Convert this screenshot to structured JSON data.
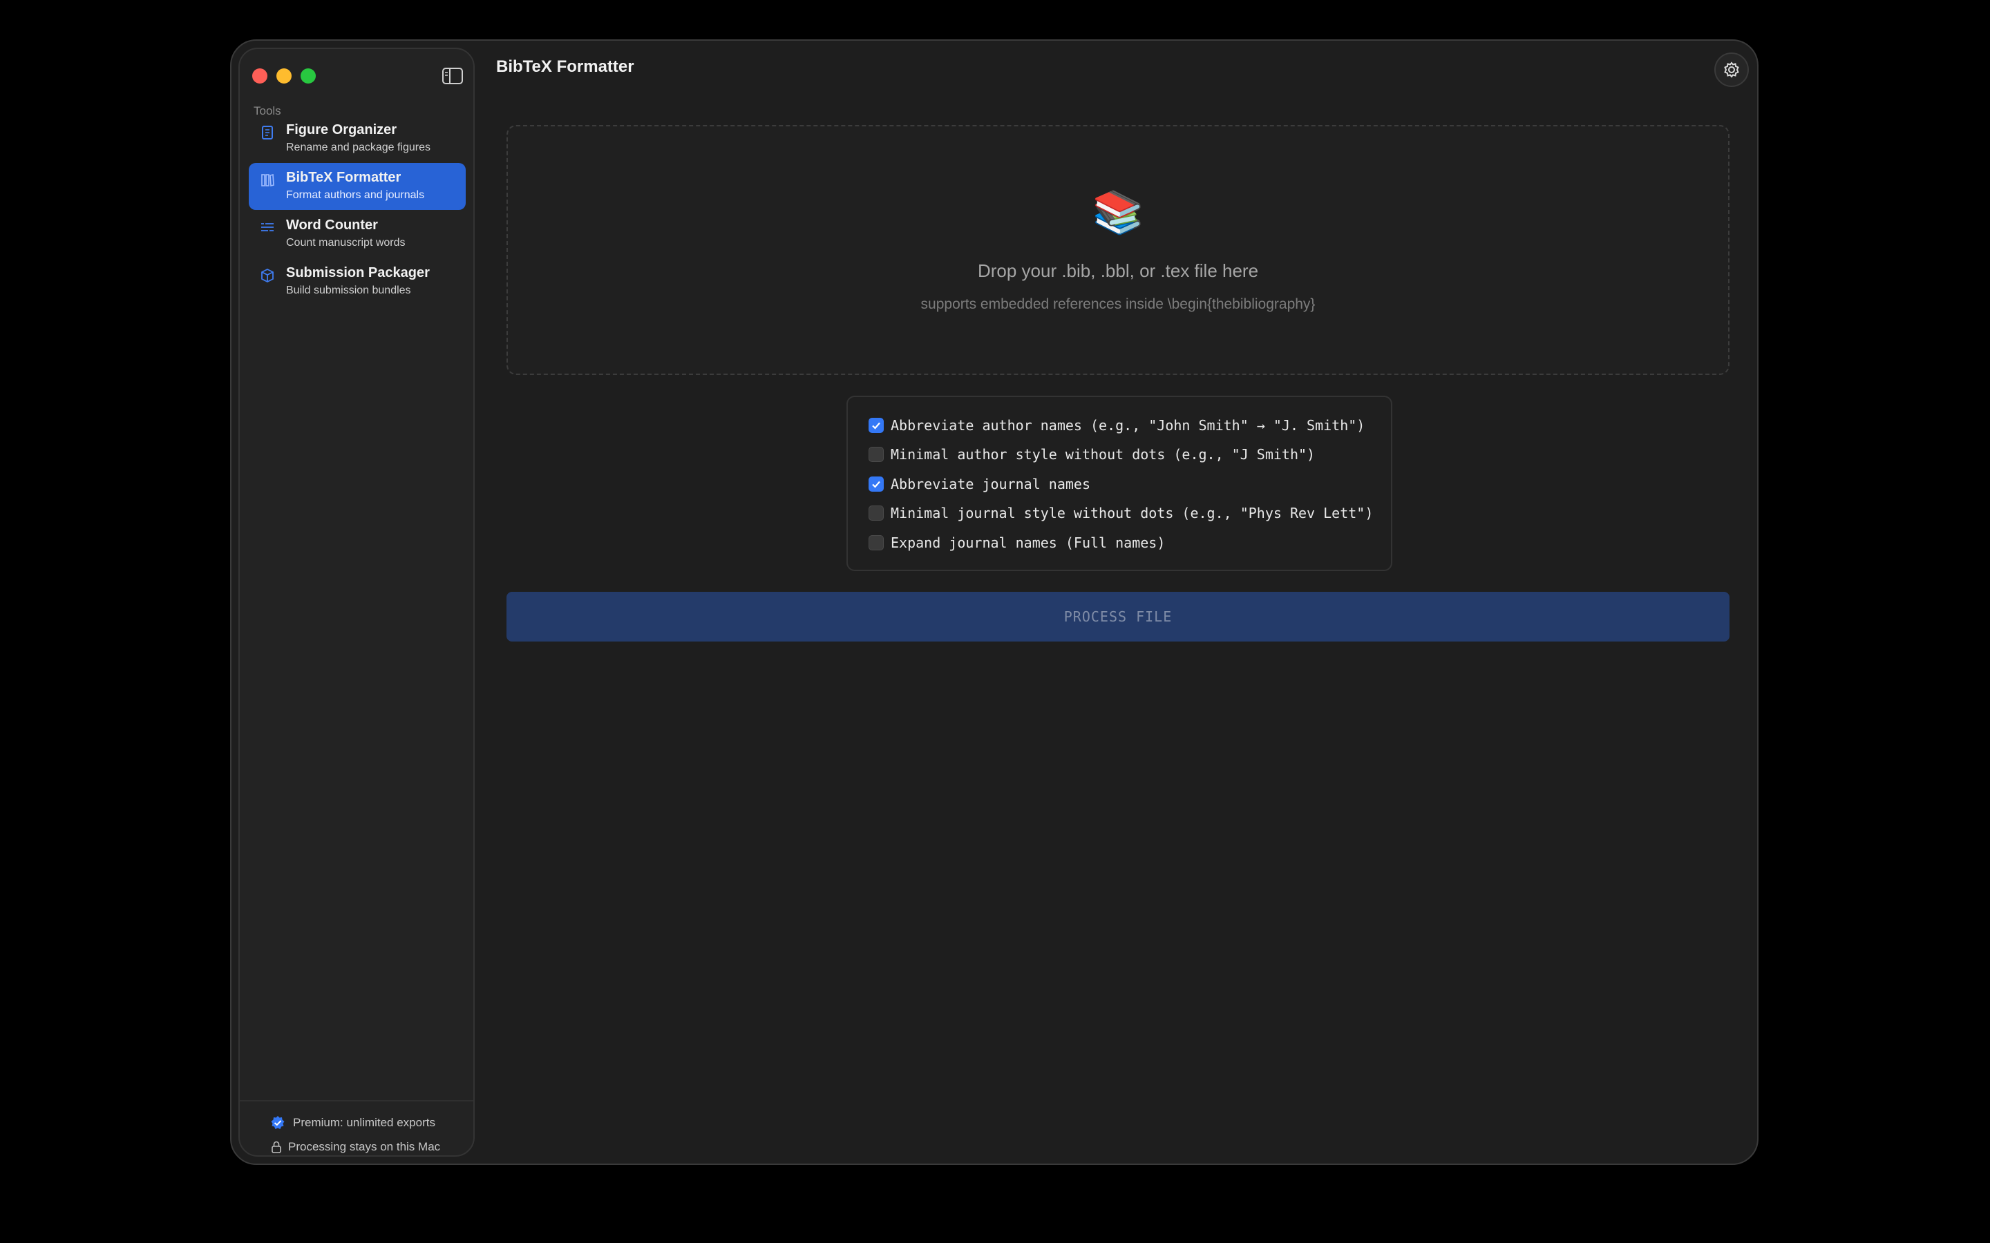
{
  "window": {
    "title": "BibTeX Formatter"
  },
  "sidebar": {
    "section_label": "Tools",
    "items": [
      {
        "title": "Figure Organizer",
        "subtitle": "Rename and package figures",
        "icon": "document-icon",
        "active": false
      },
      {
        "title": "BibTeX Formatter",
        "subtitle": "Format authors and journals",
        "icon": "books-icon",
        "active": true
      },
      {
        "title": "Word Counter",
        "subtitle": "Count manuscript words",
        "icon": "text-lines-icon",
        "active": false
      },
      {
        "title": "Submission Packager",
        "subtitle": "Build submission bundles",
        "icon": "cube-icon",
        "active": false
      }
    ],
    "footer": {
      "premium": "Premium: unlimited exports",
      "privacy": "Processing stays on this Mac"
    }
  },
  "dropzone": {
    "emoji": "📚",
    "title": "Drop your .bib, .bbl, or .tex file here",
    "subtitle": "supports embedded references inside \\begin{thebibliography}"
  },
  "options": [
    {
      "label": "Abbreviate author names (e.g., \"John Smith\" → \"J. Smith\")",
      "checked": true
    },
    {
      "label": "Minimal author style without dots (e.g., \"J Smith\")",
      "checked": false
    },
    {
      "label": "Abbreviate journal names",
      "checked": true
    },
    {
      "label": "Minimal journal style without dots (e.g., \"Phys Rev Lett\")",
      "checked": false
    },
    {
      "label": "Expand journal names (Full names)",
      "checked": false
    }
  ],
  "process_button": {
    "label": "PROCESS FILE"
  },
  "colors": {
    "accent": "#2863d6",
    "checkbox": "#3478f6",
    "background": "#1e1e1e"
  }
}
